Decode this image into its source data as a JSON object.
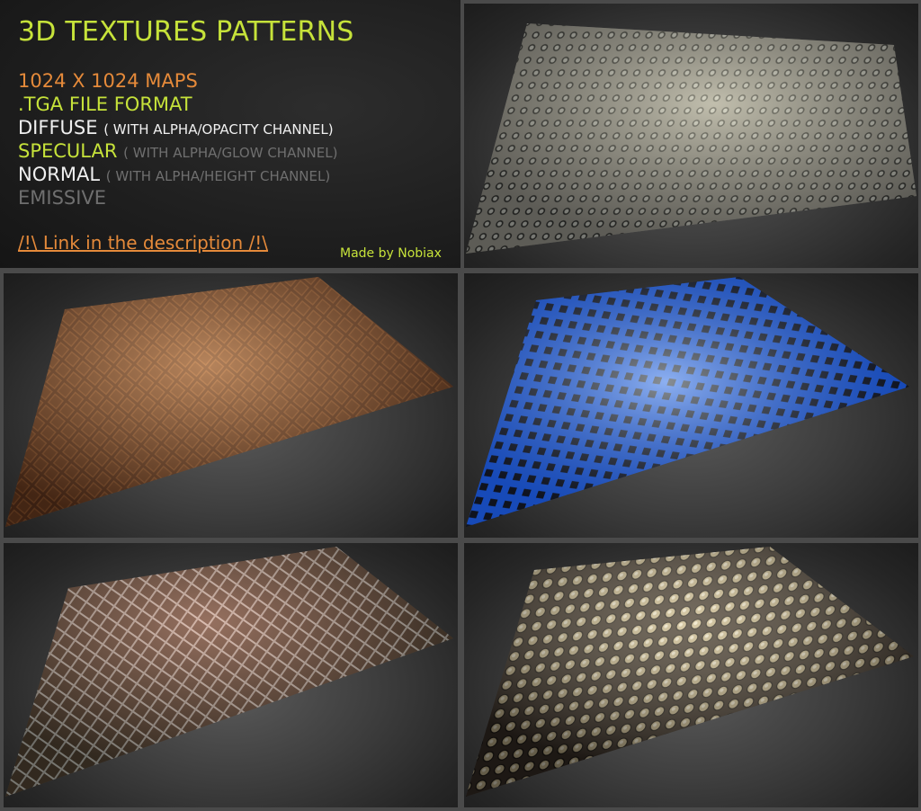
{
  "info": {
    "title": "3D TEXTURES PATTERNS",
    "maps": "1024 X 1024 MAPS",
    "format": ".TGA FILE FORMAT",
    "diffuse": "DIFFUSE",
    "diffuse_note": "( WITH ALPHA/OPACITY CHANNEL)",
    "specular": "SPECULAR",
    "specular_note": "( WITH ALPHA/GLOW CHANNEL)",
    "normal": "NORMAL",
    "normal_note": "( WITH ALPHA/HEIGHT CHANNEL)",
    "emissive": "EMISSIVE",
    "link": "/!\\ Link in the description /!\\",
    "credit": "Made by Nobiax"
  },
  "colors": {
    "accent_green": "#c6e23a",
    "accent_orange": "#e58a3a",
    "text_white": "#f0f0f0",
    "text_dim": "#6f6f6f"
  },
  "previews": [
    {
      "name": "studded-gray-metal-texture",
      "base": "#8f8d84"
    },
    {
      "name": "copper-diamond-plate-texture",
      "base": "#6a3a20"
    },
    {
      "name": "blue-square-grid-texture",
      "base": "#1e5de0"
    },
    {
      "name": "rusty-diamond-mesh-texture",
      "base": "#5a4a38"
    },
    {
      "name": "round-studded-plate-texture",
      "base": "#3a3028"
    }
  ]
}
